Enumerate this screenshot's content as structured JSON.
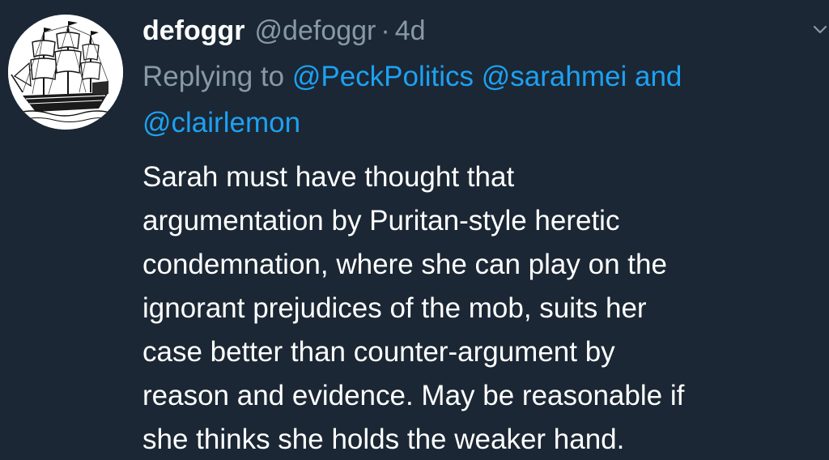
{
  "tweet": {
    "display_name": "defoggr",
    "handle": "@defoggr",
    "separator": "·",
    "age": "4d",
    "reply": {
      "prefix": "Replying to",
      "mention1": "@PeckPolitics",
      "mention2": "@sarahmei",
      "joiner": "and",
      "mention3": "@clairlemon"
    },
    "body_lines": [
      "Sarah must have thought that",
      "argumentation by Puritan-style heretic",
      "condemnation, where she can play on the",
      "ignorant prejudices of the mob, suits her",
      "case better than counter-argument by",
      "reason and evidence. May be reasonable if",
      "she thinks she holds the weaker hand."
    ]
  },
  "colors": {
    "background": "#1b2734",
    "text": "#ffffff",
    "muted": "#8899a6",
    "link": "#1da1f2"
  },
  "icons": {
    "avatar": "sailing-ship-avatar",
    "menu": "chevron-down-icon"
  }
}
